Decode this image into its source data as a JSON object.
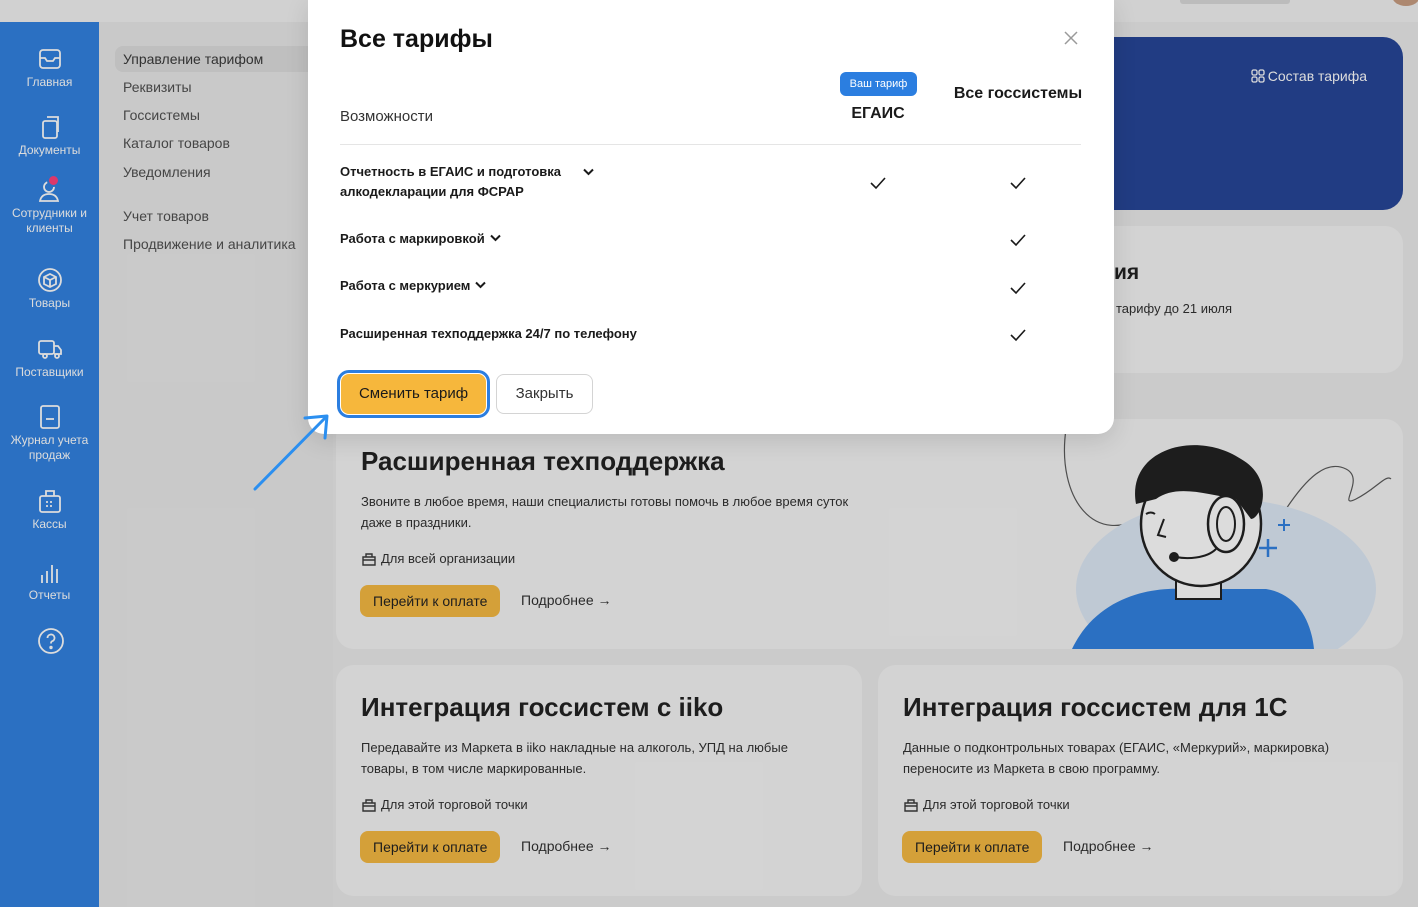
{
  "nav": [
    {
      "label": "Главная",
      "icon": "inbox-icon"
    },
    {
      "label": "Документы",
      "icon": "documents-icon"
    },
    {
      "label": "Сотрудники и клиенты",
      "icon": "users-icon"
    },
    {
      "label": "Товары",
      "icon": "box-icon"
    },
    {
      "label": "Поставщики",
      "icon": "truck-icon"
    },
    {
      "label": "Журнал учета продаж",
      "icon": "journal-icon"
    },
    {
      "label": "Кассы",
      "icon": "cash-register-icon"
    },
    {
      "label": "Отчеты",
      "icon": "bar-chart-icon"
    },
    {
      "label": "",
      "icon": "help-icon"
    }
  ],
  "submenu": {
    "items": [
      "Управление тарифом",
      "Реквизиты",
      "Госсистемы",
      "Каталог товаров",
      "Уведомления",
      "Учет товаров",
      "Продвижение и аналитика"
    ],
    "active": "Управление тарифом"
  },
  "hero": {
    "composition_link": "Состав тарифа"
  },
  "promo_card": {
    "title_fragment": "ия",
    "text": "тарифу до 21 июля"
  },
  "support_card": {
    "title": "Расширенная техподдержка",
    "description": "Звоните в любое время, наши специалисты готовы помочь в любое время суток даже в праздники.",
    "scope": "Для всей организации",
    "pay_label": "Перейти к оплате",
    "more_label": "Подробнее →"
  },
  "iiko_card": {
    "title": "Интеграция госсистем с iiko",
    "description": "Передавайте из Маркета в iiko накладные на алкоголь, УПД на любые товары, в том числе маркированные.",
    "scope": "Для этой торговой точки",
    "pay_label": "Перейти к оплате",
    "more_label": "Подробнее →"
  },
  "onec_card": {
    "title": "Интеграция госсистем для 1С",
    "description": "Данные о подконтрольных товарах (ЕГАИС, «Меркурий», маркировка) переносите из Маркета в свою программу.",
    "scope": "Для этой торговой точки",
    "pay_label": "Перейти к оплате",
    "more_label": "Подробнее →"
  },
  "modal": {
    "title": "Все тарифы",
    "features_header": "Возможности",
    "current_badge": "Ваш тариф",
    "columns": [
      "ЕГАИС",
      "Все госсистемы"
    ],
    "features": [
      {
        "name": "Отчетность в ЕГАИС и подготовка алкодекларации для ФСРАР",
        "expandable": true,
        "egais": true,
        "all": true
      },
      {
        "name": "Работа с маркировкой",
        "expandable": true,
        "egais": false,
        "all": true
      },
      {
        "name": "Работа с меркурием",
        "expandable": true,
        "egais": false,
        "all": true
      },
      {
        "name": "Расширенная техподдержка 24/7 по телефону",
        "expandable": false,
        "egais": false,
        "all": true
      }
    ],
    "change_label": "Сменить тариф",
    "close_label": "Закрыть"
  },
  "colors": {
    "rail": "#2b7ee0",
    "accent": "#f6b73c",
    "hero": "#1f3f94",
    "badge": "#2b7ee0",
    "notification": "#ff3a78"
  }
}
